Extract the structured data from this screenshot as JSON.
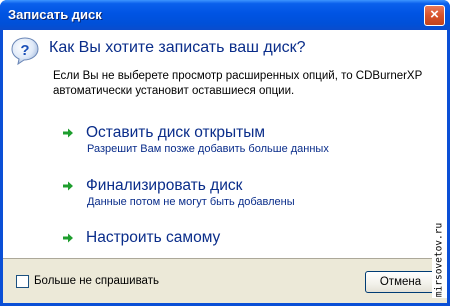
{
  "window": {
    "title": "Записать диск",
    "close_label": "×"
  },
  "content": {
    "heading": "Как Вы хотите записать ваш диск?",
    "description": "Если Вы не выберете просмотр расширенных опций, то CDBurnerXP автоматически установит оставшиеся опции.",
    "question_icon": "question-icon",
    "options": [
      {
        "title": "Оставить диск открытым",
        "subtitle": "Разрешит Вам позже добавить больше данных",
        "icon": "green-arrow-icon"
      },
      {
        "title": "Финализировать диск",
        "subtitle": "Данные потом не могут быть добавлены",
        "icon": "green-arrow-icon"
      },
      {
        "title": "Настроить самому",
        "subtitle": "",
        "icon": "green-arrow-icon"
      }
    ]
  },
  "footer": {
    "checkbox_label": "Больше не спрашивать",
    "checkbox_checked": false,
    "cancel_label": "Отмена"
  },
  "watermark": "mirsovetov.ru",
  "colors": {
    "titlebar": "#0054e3",
    "link_blue": "#0a2d8a",
    "arrow_green": "#1e9e2e",
    "close_red": "#d8532b"
  }
}
